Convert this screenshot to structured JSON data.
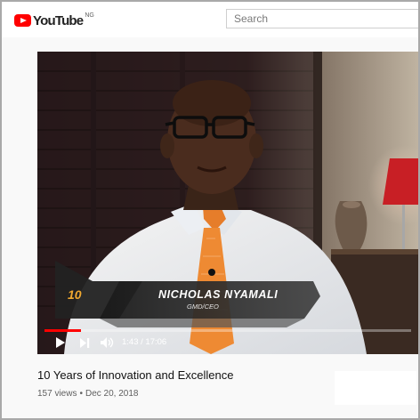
{
  "header": {
    "logo_text": "YouTube",
    "logo_region": "NG",
    "search_placeholder": "Search"
  },
  "player": {
    "lower_third": {
      "name": "NICHOLAS NYAMALI",
      "role": "GMD/CEO"
    },
    "brand_badge": "10",
    "time_display": "1:43 / 17:06",
    "progress_fraction": 0.1,
    "accent_color": "#ff0000"
  },
  "video": {
    "title": "10 Years of Innovation and Excellence",
    "views": "157 views",
    "separator": "•",
    "date": "Dec 20, 2018"
  }
}
